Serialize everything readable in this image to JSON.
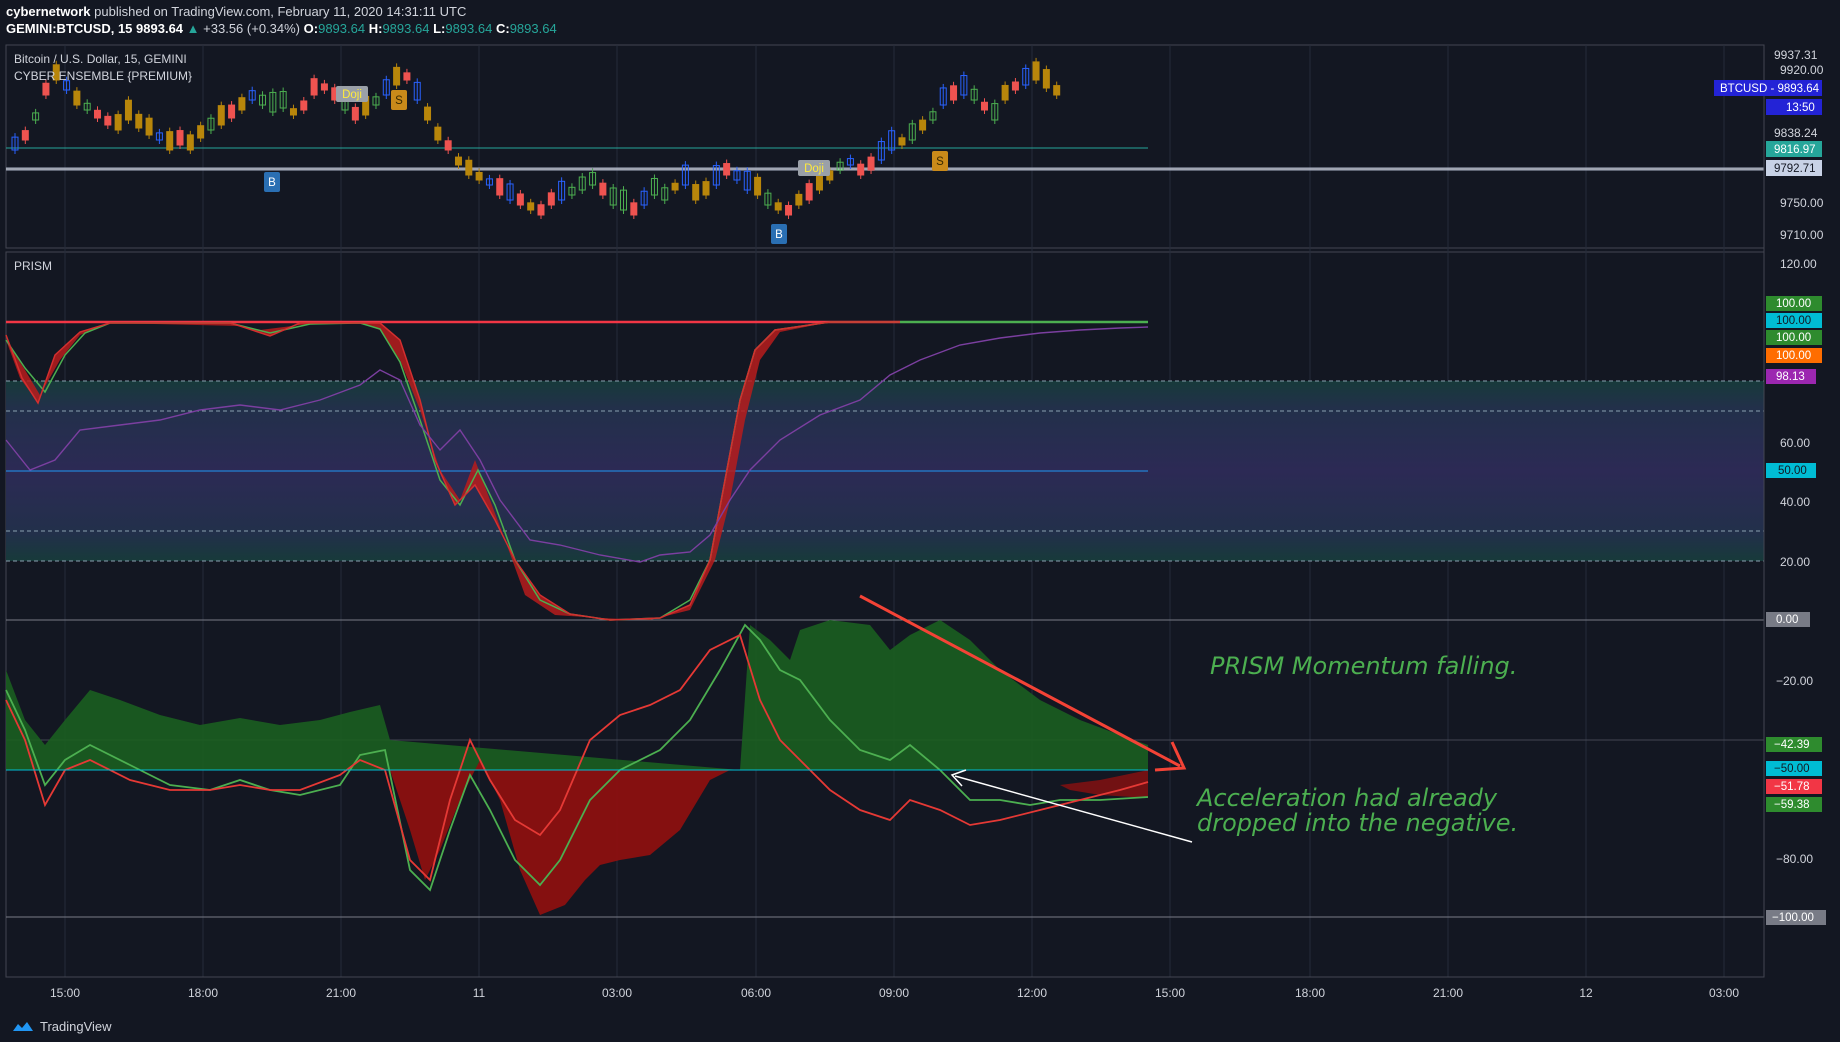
{
  "header": {
    "author": "cybernetwork",
    "published": "published on TradingView.com, February 11, 2020 14:31:11 UTC",
    "symbol": "GEMINI:BTCUSD, 15",
    "price": "9893.64",
    "change": "+33.56 (+0.34%)",
    "ohlc": [
      {
        "label": "O:",
        "value": "9893.64"
      },
      {
        "label": "H:",
        "value": "9893.64"
      },
      {
        "label": "L:",
        "value": "9893.64"
      },
      {
        "label": "C:",
        "value": "9893.64"
      }
    ]
  },
  "price_pane": {
    "title": "Bitcoin / U.S. Dollar, 15, GEMINI",
    "indicator": "CYBER ENSEMBLE {PREMIUM}",
    "axis_labels": [
      "9937.31",
      "9920.00",
      "9838.24",
      "9750.00",
      "9710.00"
    ],
    "tags": [
      {
        "text": "BTCUSD - 9893.64",
        "color": "#2323d6"
      },
      {
        "text": "13:50",
        "color": "#2323d6"
      },
      {
        "text": "9816.97",
        "color": "#26a69a"
      },
      {
        "text": "9792.71",
        "color": "#c8d2e6"
      }
    ],
    "markers": [
      "Doji",
      "S",
      "B",
      "Doji",
      "B",
      "S"
    ]
  },
  "prism_pane": {
    "title": "PRISM",
    "axis_labels": [
      "120.00",
      "60.00",
      "40.00",
      "20.00",
      "−20.00",
      "−80.00"
    ],
    "tags": [
      {
        "text": "100.00",
        "color": "#2e8b2e"
      },
      {
        "text": "100.00",
        "color": "#00bcd4"
      },
      {
        "text": "100.00",
        "color": "#2e8b2e"
      },
      {
        "text": "100.00",
        "color": "#ff6d00"
      },
      {
        "text": "98.13",
        "color": "#9c27b0"
      },
      {
        "text": "50.00",
        "color": "#00bcd4"
      },
      {
        "text": "0.00",
        "color": "#787b86"
      },
      {
        "text": "−42.39",
        "color": "#2e8b2e"
      },
      {
        "text": "−50.00",
        "color": "#00bcd4"
      },
      {
        "text": "−51.78",
        "color": "#f23645"
      },
      {
        "text": "−59.38",
        "color": "#2e8b2e"
      },
      {
        "text": "−100.00",
        "color": "#787b86"
      }
    ]
  },
  "time_axis": [
    "15:00",
    "18:00",
    "21:00",
    "11",
    "03:00",
    "06:00",
    "09:00",
    "12:00",
    "15:00",
    "18:00",
    "21:00",
    "12",
    "03:00"
  ],
  "annotations": {
    "momentum": "PRISM Momentum falling.",
    "acceleration_line1": "Acceleration had already",
    "acceleration_line2": "dropped into the negative."
  },
  "footer": {
    "brand": "TradingView"
  },
  "colors": {
    "background": "#131722",
    "green": "#4caf50",
    "red": "#f23645",
    "purple": "#7b3fa0"
  }
}
